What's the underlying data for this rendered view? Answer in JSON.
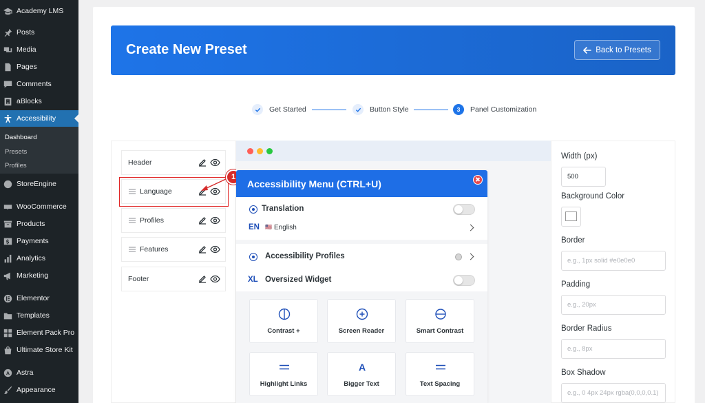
{
  "sidebar": {
    "items": [
      {
        "label": "Academy LMS",
        "icon": "graduation-cap-icon"
      },
      {
        "label": "Posts",
        "icon": "pin-icon"
      },
      {
        "label": "Media",
        "icon": "media-icon"
      },
      {
        "label": "Pages",
        "icon": "pages-icon"
      },
      {
        "label": "Comments",
        "icon": "comment-icon"
      },
      {
        "label": "aBlocks",
        "icon": "ablocks-icon"
      },
      {
        "label": "Accessibility",
        "icon": "accessibility-icon"
      },
      {
        "label": "StoreEngine",
        "icon": "storeengine-icon"
      },
      {
        "label": "WooCommerce",
        "icon": "woocommerce-icon"
      },
      {
        "label": "Products",
        "icon": "archive-icon"
      },
      {
        "label": "Payments",
        "icon": "dollar-icon"
      },
      {
        "label": "Analytics",
        "icon": "chart-bar-icon"
      },
      {
        "label": "Marketing",
        "icon": "megaphone-icon"
      },
      {
        "label": "Elementor",
        "icon": "elementor-icon"
      },
      {
        "label": "Templates",
        "icon": "folder-icon"
      },
      {
        "label": "Element Pack Pro",
        "icon": "grid-icon"
      },
      {
        "label": "Ultimate Store Kit",
        "icon": "bag-icon"
      },
      {
        "label": "Astra",
        "icon": "astra-icon"
      },
      {
        "label": "Appearance",
        "icon": "brush-icon"
      }
    ],
    "submenu": [
      "Dashboard",
      "Presets",
      "Profiles"
    ]
  },
  "banner": {
    "title": "Create New Preset",
    "back_label": "Back to Presets"
  },
  "steps": [
    {
      "label": "Get Started",
      "state": "done"
    },
    {
      "label": "Button Style",
      "state": "done"
    },
    {
      "number": "3",
      "label": "Panel Customization",
      "state": "current"
    }
  ],
  "sections": [
    "Header",
    "Language",
    "Profiles",
    "Features",
    "Footer"
  ],
  "annotation_badge": "1",
  "preview": {
    "title": "Accessibility Menu (CTRL+U)",
    "translation_label": "Translation",
    "language_code": "EN",
    "language_flag": "🇺🇸",
    "language_name": "English",
    "profiles_label": "Accessibility Profiles",
    "oversized_code": "XL",
    "oversized_label": "Oversized Widget",
    "tiles": [
      {
        "label": "Contrast +",
        "icon": "contrast-icon"
      },
      {
        "label": "Screen Reader",
        "icon": "screen-reader-icon"
      },
      {
        "label": "Smart Contrast",
        "icon": "smart-contrast-icon"
      },
      {
        "label": "Highlight Links",
        "icon": "highlight-links-icon"
      },
      {
        "label": "Bigger Text",
        "icon": "bigger-text-icon",
        "glyph": "A"
      },
      {
        "label": "Text Spacing",
        "icon": "text-spacing-icon"
      }
    ]
  },
  "settings": {
    "width_label": "Width (px)",
    "width_value": "500",
    "bg_color_label": "Background Color",
    "border_label": "Border",
    "border_placeholder": "e.g., 1px solid #e0e0e0",
    "padding_label": "Padding",
    "padding_placeholder": "e.g., 20px",
    "radius_label": "Border Radius",
    "radius_placeholder": "e.g., 8px",
    "shadow_label": "Box Shadow",
    "shadow_placeholder": "e.g., 0 4px 24px rgba(0,0,0,0.1)"
  },
  "colors": {
    "accent": "#1e74e8",
    "sidebar_bg": "#1d2327",
    "sidebar_active": "#2271b1",
    "annotation_red": "#d62c2c"
  }
}
